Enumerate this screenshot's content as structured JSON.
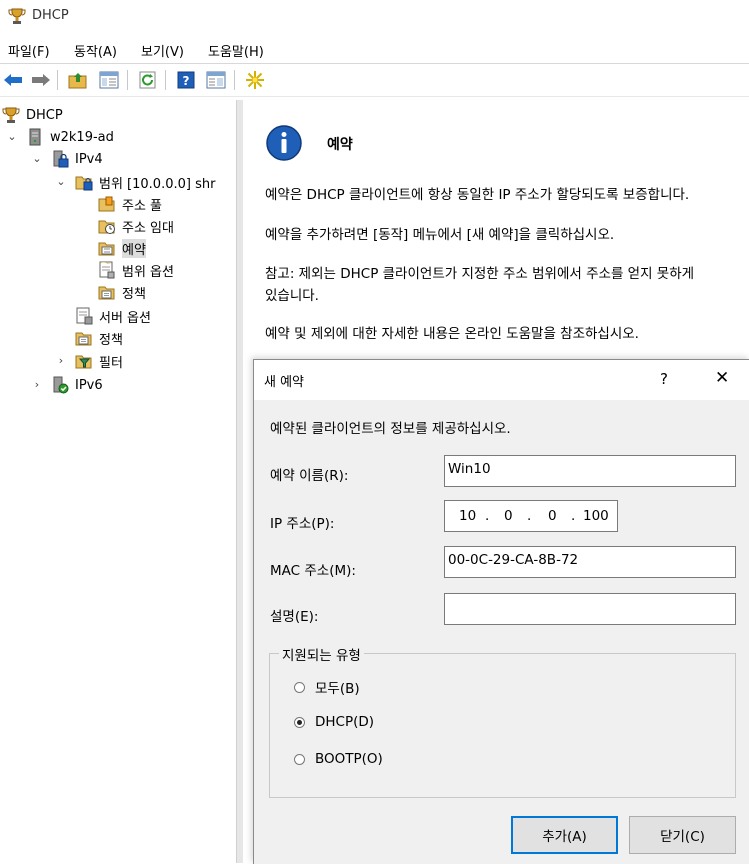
{
  "window": {
    "title": "DHCP",
    "icon": "dhcp-trophy-icon"
  },
  "menu": [
    "파일(F)",
    "동작(A)",
    "보기(V)",
    "도움말(H)"
  ],
  "toolbar": {
    "buttons": [
      "back-icon",
      "forward-icon",
      "up-folder-icon",
      "show-hide-tree-icon",
      "refresh-icon",
      "help-icon",
      "properties-icon",
      "new-star-icon"
    ]
  },
  "tree": {
    "root": "DHCP",
    "server": "w2k19-ad",
    "ipv4": "IPv4",
    "scope": "범위 [10.0.0.0] shr",
    "address_pool": "주소 풀",
    "address_leases": "주소 임대",
    "reservations": "예약",
    "scope_options": "범위 옵션",
    "scope_policies": "정책",
    "server_options": "서버 옵션",
    "policies": "정책",
    "filters": "필터",
    "ipv6": "IPv6"
  },
  "info": {
    "title": "예약",
    "p1": "예약은 DHCP 클라이언트에 항상 동일한 IP 주소가 할당되도록 보증합니다.",
    "p2": "예약을 추가하려면 [동작] 메뉴에서 [새 예약]을 클릭하십시오.",
    "p3a": "참고: 제외는 DHCP 클라이언트가 지정한 주소 범위에서 주소를 얻지 못하게",
    "p3b": "있습니다.",
    "p4": "예약 및 제외에 대한 자세한 내용은 온라인 도움말을 참조하십시오."
  },
  "dialog": {
    "title": "새 예약",
    "help": "?",
    "close": "✕",
    "instruction": "예약된 클라이언트의 정보를 제공하십시오.",
    "name_label": "예약 이름(R):",
    "name_value": "Win10",
    "ip_label": "IP 주소(P):",
    "ip": [
      "10",
      "0",
      "0",
      "100"
    ],
    "mac_label": "MAC 주소(M):",
    "mac_value": "00-0C-29-CA-8B-72",
    "desc_label": "설명(E):",
    "desc_value": "",
    "group_label": "지원되는 유형",
    "radio_both": "모두(B)",
    "radio_dhcp": "DHCP(D)",
    "radio_bootp": "BOOTP(O)",
    "selected_type": "DHCP(D)",
    "add_button": "추가(A)",
    "close_button": "닫기(C)"
  }
}
